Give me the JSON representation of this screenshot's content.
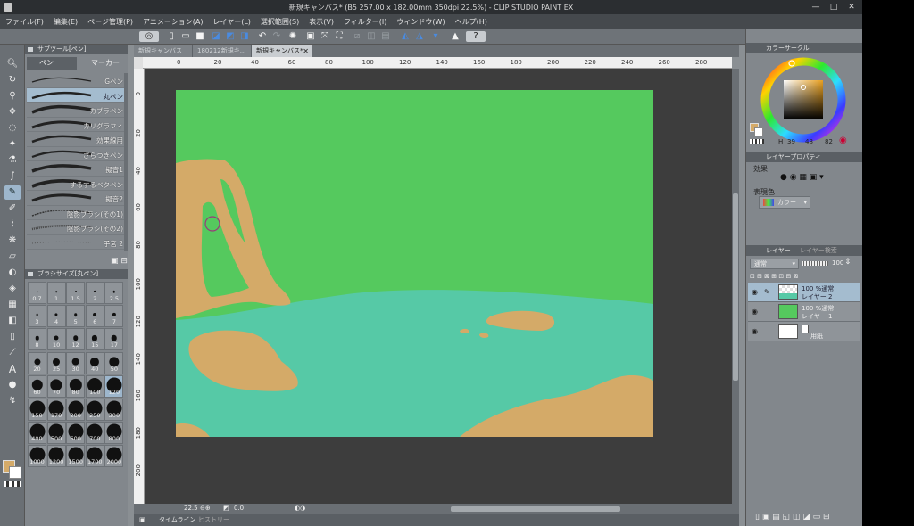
{
  "window": {
    "title": "新規キャンバス* (B5 257.00 x 182.00mm 350dpi 22.5%) - CLIP STUDIO PAINT EX",
    "minimize": "—",
    "maximize": "□",
    "close": "✕"
  },
  "menu": [
    "ファイル(F)",
    "編集(E)",
    "ページ管理(P)",
    "アニメーション(A)",
    "レイヤー(L)",
    "選択範囲(S)",
    "表示(V)",
    "フィルター(I)",
    "ウィンドウ(W)",
    "ヘルプ(H)"
  ],
  "subtool_panel": {
    "header": "サブツール[ペン]",
    "tabs": [
      "ペン",
      "マーカー"
    ],
    "brushes": [
      "Gペン",
      "丸ペン",
      "カブラペン",
      "カリグラフィ",
      "効果線用",
      "ざらつきペン",
      "擬音1",
      "するするベタペン",
      "擬音2",
      "陰影ブラシ(その1)",
      "陰影ブラシ(その2)",
      "子宮 2"
    ],
    "active_brush": "丸ペン"
  },
  "brush_size_panel": {
    "header": "ブラシサイズ[丸ペン]",
    "sizes": [
      "0.7",
      "1",
      "1.5",
      "2",
      "2.5",
      "3",
      "4",
      "5",
      "6",
      "7",
      "8",
      "10",
      "12",
      "15",
      "17",
      "20",
      "25",
      "30",
      "40",
      "50",
      "60",
      "70",
      "80",
      "100",
      "120",
      "150",
      "170",
      "200",
      "250",
      "300",
      "400",
      "500",
      "600",
      "700",
      "800",
      "1000",
      "1200",
      "1500",
      "1700",
      "2000"
    ],
    "active_size": "120"
  },
  "document_tabs": [
    {
      "label": "新規キャンバス",
      "active": false
    },
    {
      "label": "180212新規キ...",
      "active": false
    },
    {
      "label": "新規キャンバス*",
      "active": true
    }
  ],
  "ruler": {
    "horizontal": [
      "0",
      "20",
      "40",
      "60",
      "80",
      "100",
      "120",
      "140",
      "160",
      "180",
      "200",
      "220",
      "240",
      "260",
      "280"
    ],
    "vertical": [
      "0",
      "20",
      "40",
      "60",
      "80",
      "100",
      "120",
      "140",
      "160",
      "180",
      "200"
    ]
  },
  "status": {
    "zoom": "22.5",
    "angle": "0.0"
  },
  "timeline": {
    "tabs": [
      "タイムライン",
      "ヒストリー"
    ]
  },
  "color_panel": {
    "header": "カラーサークル",
    "h_label": "H",
    "h_value": "39",
    "s_value": "48",
    "v_value": "82",
    "main_color": "#d4aa68",
    "sub_color": "#ffffff"
  },
  "layer_property_panel": {
    "header": "レイヤープロパティ",
    "effect_label": "効果",
    "expression_label": "表現色",
    "expression_value": "カラー"
  },
  "layer_panel": {
    "header": "レイヤー",
    "second_tab": "レイヤー検索",
    "blend_mode": "通常",
    "opacity": "100",
    "layers": [
      {
        "line1": "100 %通常",
        "line2": "レイヤー 2",
        "thumb": "#56c9a6",
        "active": true
      },
      {
        "line1": "100 %通常",
        "line2": "レイヤー 1",
        "thumb": "#55c95e",
        "active": false
      },
      {
        "line1": "",
        "line2": "用紙",
        "thumb": "#ffffff",
        "active": false
      }
    ]
  },
  "canvas": {
    "colors": {
      "grass": "#55c95e",
      "water": "#56c9a6",
      "sand": "#d4aa68",
      "cursor": "#9a3a7a"
    }
  }
}
